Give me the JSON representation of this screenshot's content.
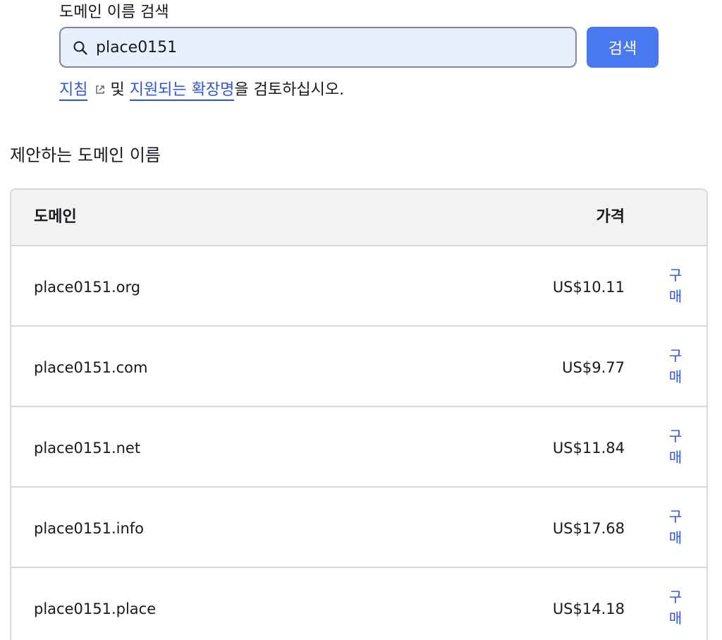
{
  "search": {
    "label": "도메인 이름 검색",
    "value": "place0151",
    "button_label": "검색"
  },
  "guide": {
    "link_guidelines": "지침",
    "connector": "및",
    "link_extensions": "지원되는 확장명",
    "suffix": "을 검토하십시오."
  },
  "suggestions": {
    "title": "제안하는 도메인 이름",
    "headers": {
      "domain": "도메인",
      "price": "가격"
    },
    "rows": [
      {
        "domain": "place0151.org",
        "price": "US$10.11",
        "action": "구매"
      },
      {
        "domain": "place0151.com",
        "price": "US$9.77",
        "action": "구매"
      },
      {
        "domain": "place0151.net",
        "price": "US$11.84",
        "action": "구매"
      },
      {
        "domain": "place0151.info",
        "price": "US$17.68",
        "action": "구매"
      },
      {
        "domain": "place0151.place",
        "price": "US$14.18",
        "action": "구매"
      }
    ]
  },
  "colors": {
    "accent": "#4a78ef",
    "link": "#2f55d4",
    "input_bg": "#e9f0fd",
    "header_bg": "#f2f2f2",
    "border": "#d5dbdb"
  },
  "icons": {
    "search": "search-icon",
    "external": "external-link-icon"
  }
}
